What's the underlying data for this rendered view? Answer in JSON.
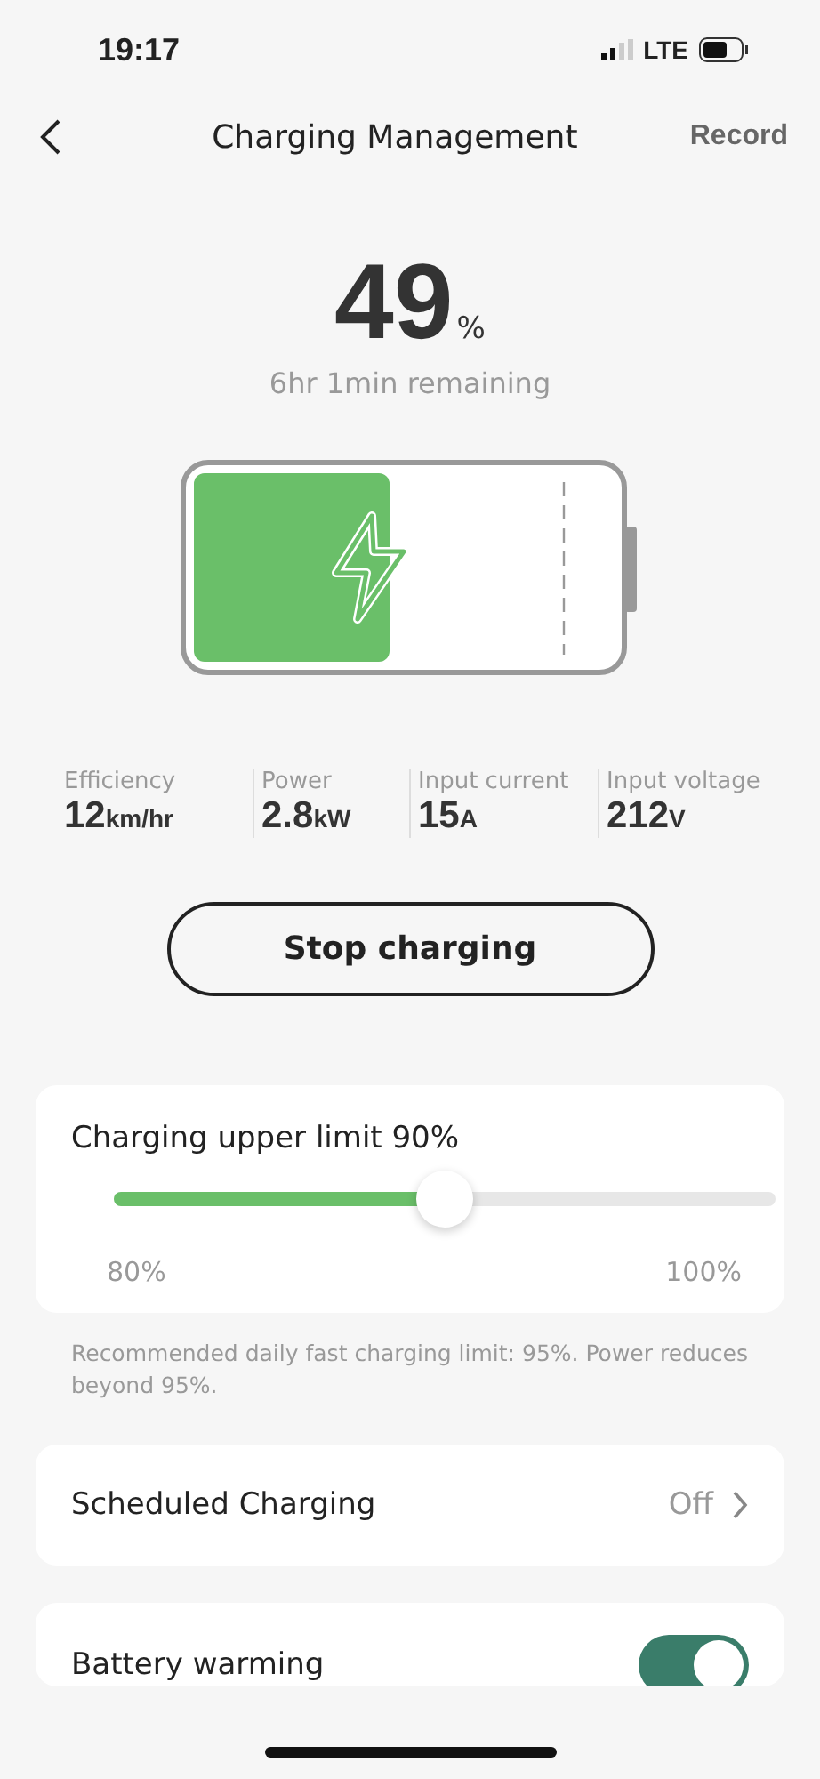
{
  "status_bar": {
    "time": "19:17",
    "network": "LTE"
  },
  "nav": {
    "title": "Charging Management",
    "action": "Record"
  },
  "charge": {
    "percent": "49",
    "unit": "%",
    "remaining": "6hr 1min remaining"
  },
  "stats": [
    {
      "label": "Efficiency",
      "value": "12",
      "unit": "km/hr"
    },
    {
      "label": "Power",
      "value": "2.8",
      "unit": "kW"
    },
    {
      "label": "Input current",
      "value": "15",
      "unit": "A"
    },
    {
      "label": "Input voltage",
      "value": "212",
      "unit": "V"
    }
  ],
  "stop_button": "Stop charging",
  "limit": {
    "title": "Charging upper limit 90%",
    "level": 0.5,
    "min": "80%",
    "max": "100%"
  },
  "note": "Recommended daily fast charging limit: 95%. Power reduces beyond 95%.",
  "settings": [
    {
      "kind": "link",
      "label": "Scheduled Charging",
      "value": "Off"
    },
    {
      "kind": "toggle",
      "label": "Battery warming",
      "on": true
    }
  ]
}
